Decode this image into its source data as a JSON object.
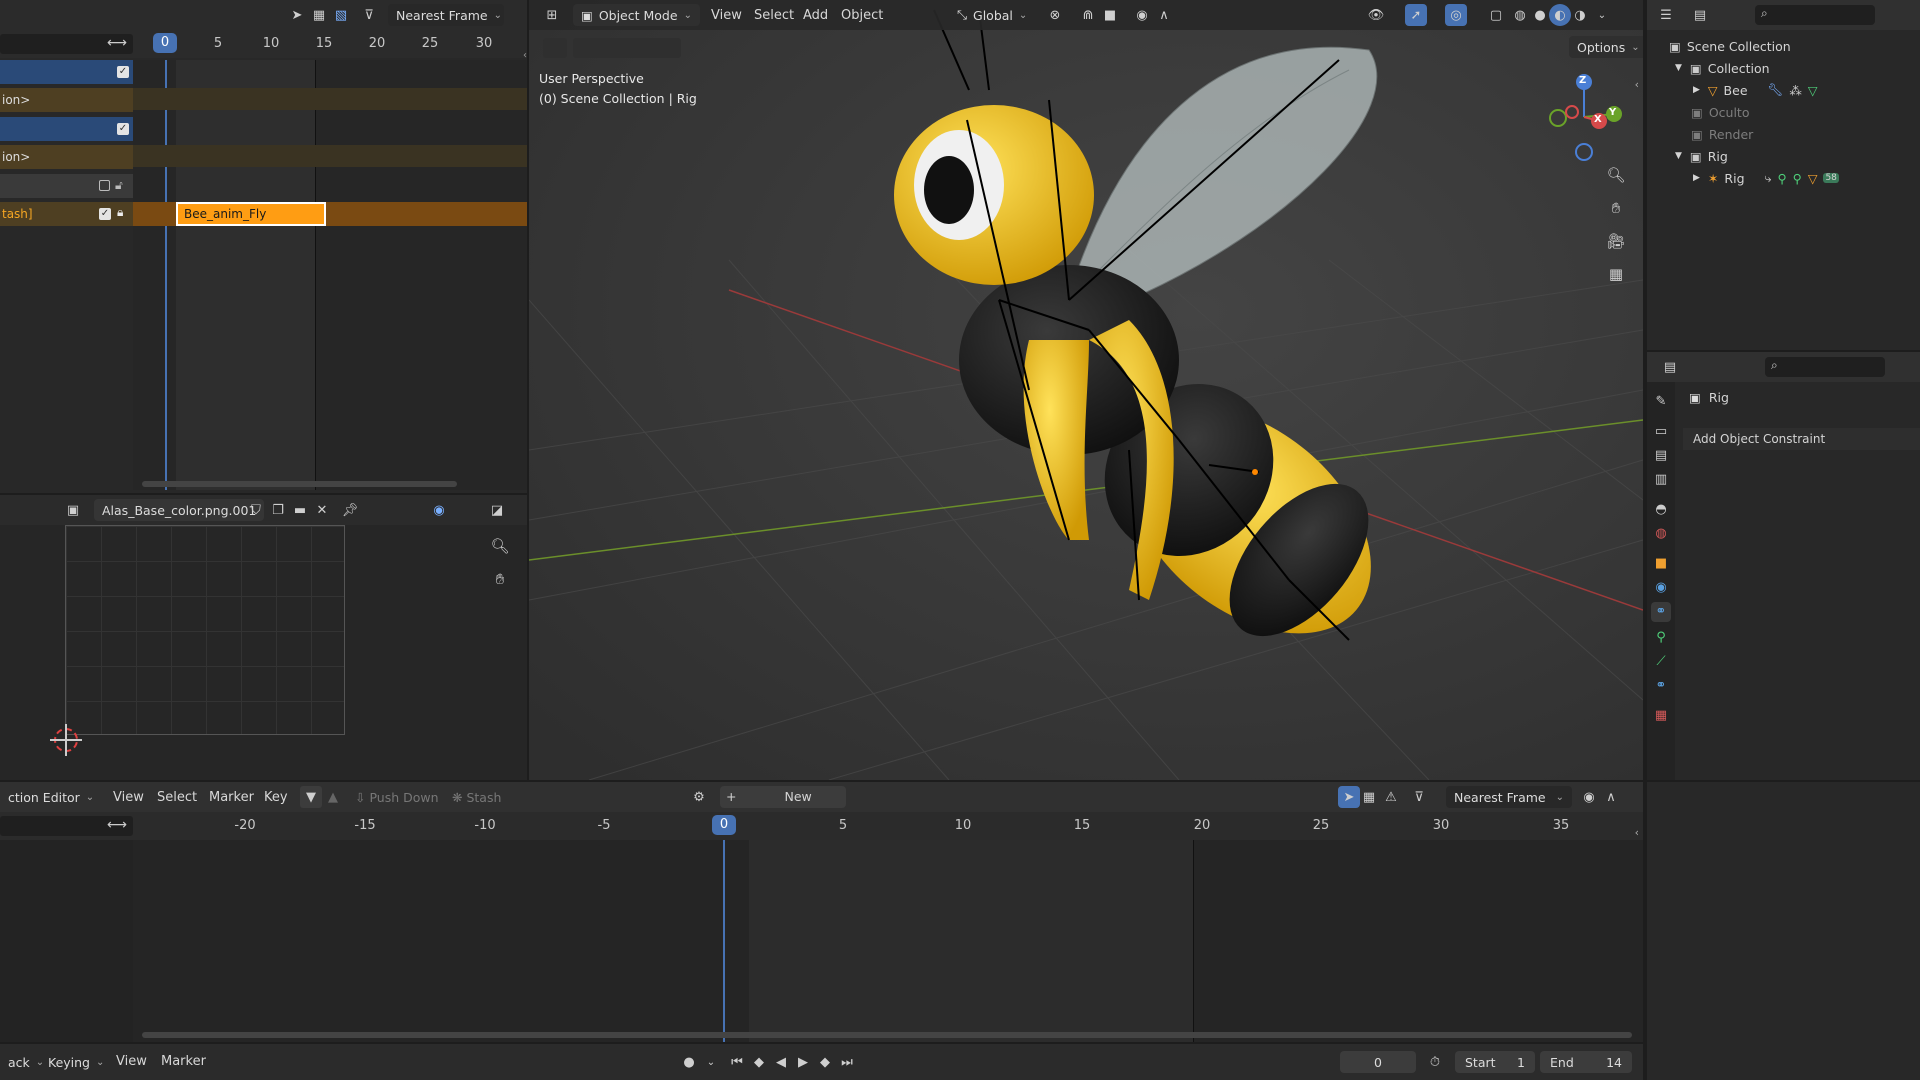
{
  "nla": {
    "snap_mode": "Nearest Frame",
    "current_frame": "0",
    "ticks": [
      "5",
      "10",
      "15",
      "20",
      "25",
      "30"
    ],
    "tracks": [
      {
        "label": ""
      },
      {
        "label": "ion>"
      },
      {
        "label": ""
      },
      {
        "label": "ion>"
      },
      {
        "label": ""
      },
      {
        "label": "tash]"
      }
    ],
    "strip_name": "Bee_anim_Fly"
  },
  "image_editor": {
    "image_name": "Alas_Base_color.png.001"
  },
  "viewport": {
    "mode": "Object Mode",
    "menus": [
      "View",
      "Select",
      "Add",
      "Object"
    ],
    "orientation": "Global",
    "options_label": "Options",
    "perspective": "User Perspective",
    "collection_info": "(0) Scene Collection | Rig",
    "gizmo": {
      "z": "Z",
      "y": "Y",
      "x": "X"
    }
  },
  "outliner": {
    "rows": [
      {
        "label": "Scene Collection",
        "icon": "scene-collection-icon"
      },
      {
        "label": "Collection",
        "icon": "collection-icon"
      },
      {
        "label": "Bee",
        "icon": "mesh-icon"
      },
      {
        "label": "Oculto",
        "icon": "collection-icon"
      },
      {
        "label": "Render",
        "icon": "collection-icon"
      },
      {
        "label": "Rig",
        "icon": "collection-icon"
      },
      {
        "label": "Rig",
        "icon": "armature-icon"
      }
    ],
    "rig_child_count": "58"
  },
  "properties": {
    "object_name": "Rig",
    "add_constraint": "Add Object Constraint"
  },
  "action_editor": {
    "editor_label": "ction Editor",
    "menus": [
      "View",
      "Select",
      "Marker",
      "Key"
    ],
    "push_down": "Push Down",
    "stash": "Stash",
    "new_label": "New",
    "snap_mode": "Nearest Frame",
    "current_frame": "0",
    "ticks": [
      "-20",
      "-15",
      "-10",
      "-5",
      "5",
      "10",
      "15",
      "20",
      "25",
      "30",
      "35"
    ]
  },
  "timeline": {
    "playback": "ack",
    "keying": "Keying",
    "view": "View",
    "marker": "Marker",
    "frame": "0",
    "start_label": "Start",
    "start_value": "1",
    "end_label": "End",
    "end_value": "14"
  },
  "colors": {
    "accent": "#4772b3",
    "strip": "#ff9d13",
    "track_action": "#4e3f22",
    "track_blue": "#2a4a78",
    "bee_yellow": "#f2c21a"
  }
}
